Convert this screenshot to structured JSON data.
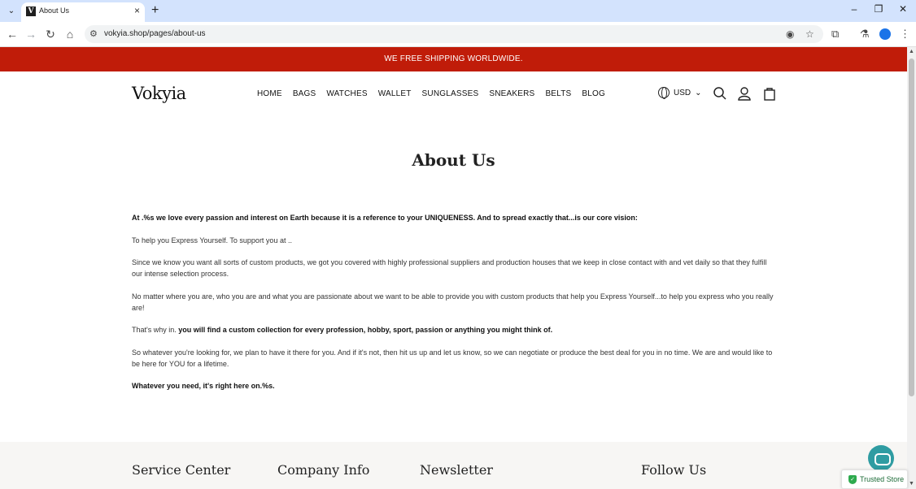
{
  "browser": {
    "tab_title": "About Us",
    "tab_favicon": "V",
    "url": "vokyia.shop/pages/about-us"
  },
  "announcement": "WE FREE SHIPPING WORLDWIDE.",
  "header": {
    "logo": "Vokyia",
    "nav": [
      "HOME",
      "BAGS",
      "WATCHES",
      "WALLET",
      "SUNGLASSES",
      "SNEAKERS",
      "BELTS",
      "BLOG"
    ],
    "currency": "USD"
  },
  "page_title": "About Us",
  "content": {
    "p1": "At .%s we love every passion and interest on Earth because it is a reference to your UNIQUENESS. And to spread exactly that...is our core vision:",
    "p2": "To help you Express Yourself. To support you at ..",
    "p3": "Since we know you want all sorts of custom products, we got you covered with highly professional suppliers and production houses that we keep in close contact with and vet daily so that they fulfill our intense selection process.",
    "p4": "No matter where you are, who you are and what you are passionate about we want to be able to provide you with custom products that help you Express Yourself...to help you express who you really are!",
    "p5_prefix": "That's why in. ",
    "p5_bold": "you will find a custom collection for every profession, hobby, sport, passion or anything you might think of.",
    "p6": "So whatever you're looking for, we plan to have it there for you. And if it's not, then hit us up and let us know, so we can negotiate or produce the best deal for you in no time. We are and would like to be here for YOU for a lifetime.",
    "p7": "Whatever you need, it's right here on.%s."
  },
  "footer": {
    "col1": "Service Center",
    "col2": "Company Info",
    "col3": "Newsletter",
    "col4": "Follow Us"
  },
  "widgets": {
    "trusted": "Trusted Store"
  },
  "colors": {
    "announcement_bg": "#c01c09",
    "footer_bg": "#f7f6f4",
    "chat_btn": "#2f9ca2"
  }
}
